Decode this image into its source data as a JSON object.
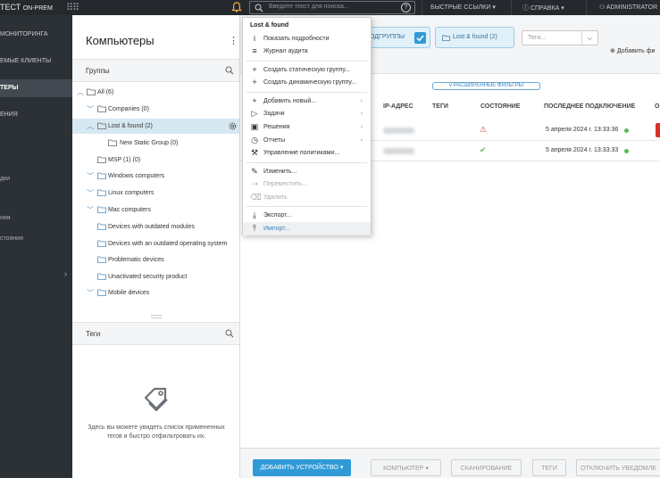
{
  "topbar": {
    "brand": "ТЕСТ",
    "brand_suffix": "ON-PREM",
    "search_placeholder": "Введите текст для поиска...",
    "help": "?",
    "quick_links": "БЫСТРЫЕ ССЫЛКИ",
    "help_menu": "СПРАВКА",
    "user": "ADMINISTRATOR",
    "chevron": "▾"
  },
  "nav": {
    "items": [
      "МОНИТОРИНГА",
      "ЕМЫЕ КЛИЕНТЫ",
      "ТЕРЫ",
      "ЕНИЯ"
    ],
    "small": [
      "дки",
      "ния",
      "стояния"
    ],
    "expand": "›"
  },
  "groups_panel": {
    "title": "Компьютеры",
    "menu": "⋮",
    "groups_label": "Группы",
    "tree": [
      {
        "label": "All (6)",
        "chevron": "^"
      },
      {
        "label": "Companies (0)",
        "chevron": "v"
      },
      {
        "label": "Lost & found (2)",
        "chevron": "^"
      },
      {
        "label": "New Static Group (0)",
        "chevron": ""
      },
      {
        "label": "MSP (1) (0)",
        "chevron": "v"
      },
      {
        "label": "Windows computers",
        "chevron": "v"
      },
      {
        "label": "Linux computers",
        "chevron": "v"
      },
      {
        "label": "Mac computers",
        "chevron": "v"
      },
      {
        "label": "Devices with outdated modules",
        "chevron": ""
      },
      {
        "label": "Devices with an outdated operating system",
        "chevron": ""
      },
      {
        "label": "Problematic devices",
        "chevron": ""
      },
      {
        "label": "Unactivated security product",
        "chevron": ""
      },
      {
        "label": "Mobile devices",
        "chevron": "v"
      }
    ],
    "tags_label": "Теги",
    "tags_message": "Здесь вы можете увидеть список примененных тегов и быстро отфильтровать их."
  },
  "filters": {
    "subgroups_chip": "ОДГРУППЫ",
    "group_chip": "Lost & found (2)",
    "tags_placeholder": "Теги...",
    "add_filter": "Добавить фи",
    "advanced_filters": "РАСШИРЕННЫЕ ФИЛЬТРЫ",
    "advanced_chevron": "v"
  },
  "table": {
    "headers": {
      "ip": "IP-АДРЕС",
      "tags": "ТЕГИ",
      "status": "СОСТОЯНИЕ",
      "last_connection": "ПОСЛЕДНЕЕ ПОДКЛЮЧЕНИЕ",
      "extra": "О"
    },
    "rows": [
      {
        "status": "warning",
        "status_icon": "⚠",
        "last_connection": "5 апреля 2024 г. 13:33:36"
      },
      {
        "status": "ok",
        "status_icon": "✔",
        "last_connection": "5 апреля 2024 г. 13:33:33"
      }
    ],
    "colors": {
      "warning": "#d9302c",
      "ok": "#5cb85c"
    }
  },
  "bottombar": {
    "add_device": "ДОБАВИТЬ УСТРОЙСТВО",
    "computer": "КОМПЬЮТЕР",
    "scan": "СКАНИРОВАНИЕ",
    "tags": "ТЕГИ",
    "disable_notifications": "ОТКЛЮЧИТЬ УВЕДОМЛЕ",
    "chevron": "▾"
  },
  "context_menu": {
    "title": "Lost & found",
    "items": [
      {
        "icon": "info-icon",
        "glyph": "i",
        "label": "Показать подробности",
        "submenu": false,
        "disabled": false
      },
      {
        "icon": "audit-log-icon",
        "glyph": "≡",
        "label": "Журнал аудита",
        "submenu": false,
        "disabled": false
      },
      {
        "icon": "plus-icon",
        "glyph": "+",
        "label": "Создать статическую группу...",
        "submenu": false,
        "disabled": false
      },
      {
        "icon": "plus-icon",
        "glyph": "+",
        "label": "Создать динамическую группу...",
        "submenu": false,
        "disabled": false
      },
      {
        "icon": "plus-icon",
        "glyph": "+",
        "label": "Добавить новый...",
        "submenu": true,
        "disabled": false
      },
      {
        "icon": "play-icon",
        "glyph": "▷",
        "label": "Задачи",
        "submenu": true,
        "disabled": false
      },
      {
        "icon": "solutions-icon",
        "glyph": "▣",
        "label": "Решения",
        "submenu": true,
        "disabled": false
      },
      {
        "icon": "reports-icon",
        "glyph": "◷",
        "label": "Отчеты",
        "submenu": true,
        "disabled": false
      },
      {
        "icon": "wrench-icon",
        "glyph": "⚒",
        "label": "Управление политиками...",
        "submenu": false,
        "disabled": false
      },
      {
        "icon": "pencil-icon",
        "glyph": "✎",
        "label": "Изменить...",
        "submenu": false,
        "disabled": false
      },
      {
        "icon": "move-icon",
        "glyph": "⇢",
        "label": "Переместить...",
        "submenu": false,
        "disabled": true
      },
      {
        "icon": "trash-icon",
        "glyph": "⌫",
        "label": "Удалить",
        "submenu": false,
        "disabled": true
      },
      {
        "icon": "export-icon",
        "glyph": "⤓",
        "label": "Экспорт...",
        "submenu": false,
        "disabled": false
      },
      {
        "icon": "import-icon",
        "glyph": "⤒",
        "label": "Импорт...",
        "submenu": false,
        "disabled": false
      }
    ],
    "submenu_arrow": "›"
  }
}
